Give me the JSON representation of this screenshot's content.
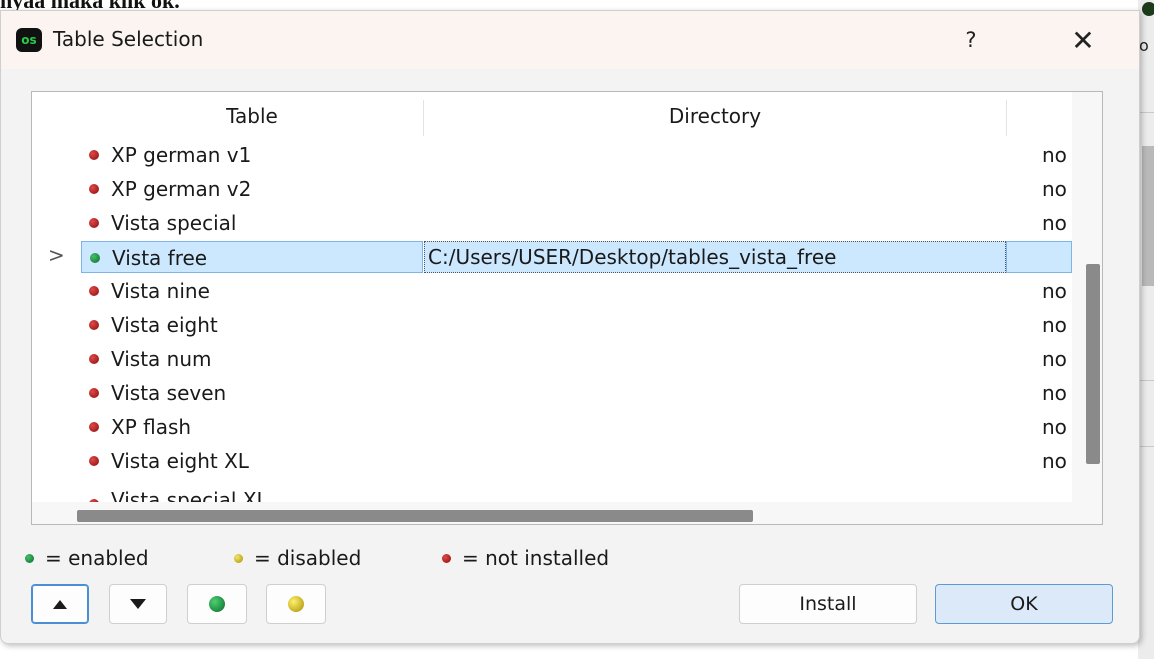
{
  "background": {
    "doc_text": "nyaa maka klik ok."
  },
  "dialog": {
    "app_icon_text": "os",
    "title": "Table Selection",
    "help_label": "?",
    "close_label": "✕"
  },
  "table": {
    "columns": [
      "Table",
      "Directory"
    ],
    "rows": [
      {
        "name": "XP german v1",
        "status_color": "red",
        "directory": "",
        "extra": "no"
      },
      {
        "name": "XP german v2",
        "status_color": "red",
        "directory": "",
        "extra": "no"
      },
      {
        "name": "Vista special",
        "status_color": "red",
        "directory": "",
        "extra": "no"
      },
      {
        "name": "Vista free",
        "status_color": "green",
        "directory": "C:/Users/USER/Desktop/tables_vista_free",
        "extra": "",
        "selected": true
      },
      {
        "name": "Vista nine",
        "status_color": "red",
        "directory": "",
        "extra": "no"
      },
      {
        "name": "Vista eight",
        "status_color": "red",
        "directory": "",
        "extra": "no"
      },
      {
        "name": "Vista num",
        "status_color": "red",
        "directory": "",
        "extra": "no"
      },
      {
        "name": "Vista seven",
        "status_color": "red",
        "directory": "",
        "extra": "no"
      },
      {
        "name": "XP flash",
        "status_color": "red",
        "directory": "",
        "extra": "no"
      },
      {
        "name": "Vista eight XL",
        "status_color": "red",
        "directory": "",
        "extra": "no"
      }
    ],
    "partial_row": "Vista special XL",
    "selected_marker": ">"
  },
  "legend": [
    {
      "color": "green",
      "label": "= enabled"
    },
    {
      "color": "yellow",
      "label": "= disabled"
    },
    {
      "color": "red",
      "label": "= not installed"
    }
  ],
  "buttons": {
    "install": "Install",
    "ok": "OK"
  },
  "colors": {
    "selection": "#cce8ff",
    "primary_button": "#dbe9f8",
    "enabled": "#1f9b45",
    "disabled": "#d8c21a",
    "not_installed": "#b01818"
  }
}
